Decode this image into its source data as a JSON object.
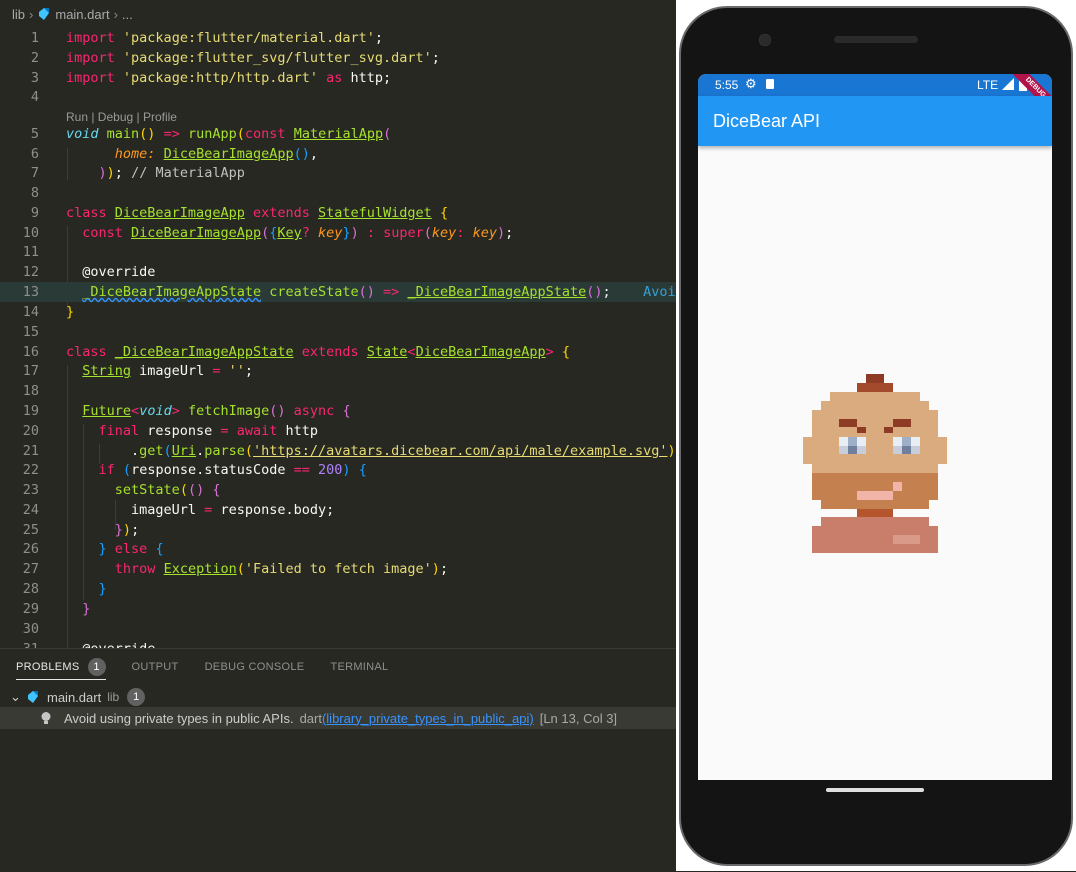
{
  "breadcrumb": {
    "folder": "lib",
    "file": "main.dart",
    "more": "..."
  },
  "codelens": "Run | Debug | Profile",
  "code": {
    "l1": "1",
    "l2": "2",
    "l3": "3",
    "l4": "4",
    "l5": "5",
    "l6": "6",
    "l7": "7",
    "l8": "8",
    "l9": "9",
    "l10": "10",
    "l11": "11",
    "l12": "12",
    "l13": "13",
    "l14": "14",
    "l15": "15",
    "l16": "16",
    "l17": "17",
    "l18": "18",
    "l19": "19",
    "l20": "20",
    "l21": "21",
    "l22": "22",
    "l23": "23",
    "l24": "24",
    "l25": "25",
    "l26": "26",
    "l27": "27",
    "l28": "28",
    "l29": "29",
    "l30": "30",
    "l31": "31"
  },
  "inline_hint": "Avoid",
  "panel": {
    "tabs": [
      "PROBLEMS",
      "OUTPUT",
      "DEBUG CONSOLE",
      "TERMINAL"
    ],
    "problems_count": "1",
    "file_name": "main.dart",
    "file_folder": "lib",
    "file_count": "1",
    "problem_message": "Avoid using private types in public APIs.",
    "problem_source": "dart",
    "problem_code": "(library_private_types_in_public_api)",
    "problem_location": "[Ln 13, Col 3]"
  },
  "phone": {
    "time": "5:55",
    "network": "LTE",
    "debug_banner": "DEBUG",
    "app_title": "DiceBear API"
  },
  "colors": {
    "appbar": "#2196f3",
    "statusbar": "#1976d2",
    "editor_bg": "#272822"
  }
}
